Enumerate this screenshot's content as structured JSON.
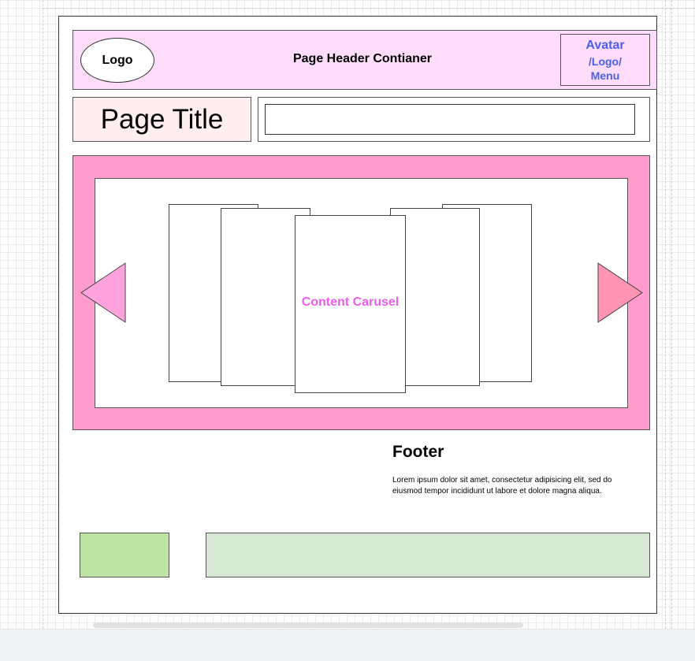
{
  "header": {
    "logo_label": "Logo",
    "title": "Page Header Contianer",
    "avatar_lines": [
      "Avatar",
      "/Logo/",
      "Menu"
    ]
  },
  "page_title": "Page Title",
  "search": {
    "value": ""
  },
  "carousel": {
    "label": "Content Carusel"
  },
  "footer": {
    "heading": "Footer",
    "text": "Lorem ipsum dolor sit amet, consectetur adipisicing elit, sed do eiusmod tempor incididunt ut labore et dolore magna aliqua."
  },
  "colors": {
    "header_bg": "#ffdcf9",
    "title_bg": "#ffeef0",
    "carousel_bg": "#ff9ccd",
    "arrow_left": "#ffa3df",
    "arrow_right": "#ff94b4",
    "carousel_label": "#f05bf0",
    "avatar_text": "#4a5ff0",
    "green_small": "#bde3a5",
    "green_wide": "#d7e8d5"
  }
}
